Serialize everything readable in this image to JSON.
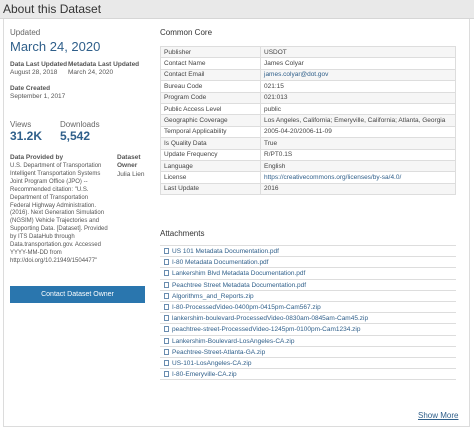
{
  "header": {
    "title": "About this Dataset"
  },
  "summary": {
    "updated_label": "Updated",
    "updated_date": "March 24, 2020",
    "data_last_updated_label": "Data Last Updated",
    "data_last_updated": "August 28, 2018",
    "metadata_last_updated_label": "Metadata Last Updated",
    "metadata_last_updated": "March 24, 2020",
    "date_created_label": "Date Created",
    "date_created": "September 1, 2017",
    "views_label": "Views",
    "views": "31.2K",
    "downloads_label": "Downloads",
    "downloads": "5,542",
    "provided_by_label": "Data Provided by",
    "provided_by": "U.S. Department of Transportation Intelligent Transportation Systems Joint Program Office (JPO) -- Recommended citation: \"U.S. Department of Transportation Federal Highway Administration. (2016). Next Generation Simulation (NGSIM) Vehicle Trajectories and Supporting Data. [Dataset]. Provided by ITS DataHub through Data.transportation.gov. Accessed YYYY-MM-DD from http://doi.org/10.21949/1504477\"",
    "owner_label": "Dataset Owner",
    "owner": "Julia Lien",
    "contact_button": "Contact Dataset Owner"
  },
  "common_core": {
    "title": "Common Core",
    "rows": [
      {
        "key": "Publisher",
        "value": "USDOT",
        "link": false
      },
      {
        "key": "Contact Name",
        "value": "James Colyar",
        "link": false
      },
      {
        "key": "Contact Email",
        "value": "james.colyar@dot.gov",
        "link": true
      },
      {
        "key": "Bureau Code",
        "value": "021:15",
        "link": false
      },
      {
        "key": "Program Code",
        "value": "021:013",
        "link": false
      },
      {
        "key": "Public Access Level",
        "value": "public",
        "link": false
      },
      {
        "key": "Geographic Coverage",
        "value": "Los Angeles, California; Emeryville, California; Atlanta, Georgia",
        "link": false
      },
      {
        "key": "Temporal Applicability",
        "value": "2005-04-20/2006-11-09",
        "link": false
      },
      {
        "key": "Is Quality Data",
        "value": "True",
        "link": false
      },
      {
        "key": "Update Frequency",
        "value": "R/PT0.1S",
        "link": false
      },
      {
        "key": "Language",
        "value": "English",
        "link": false
      },
      {
        "key": "License",
        "value": "https://creativecommons.org/licenses/by-sa/4.0/",
        "link": true
      },
      {
        "key": "Last Update",
        "value": "2016",
        "link": false
      }
    ]
  },
  "attachments": {
    "title": "Attachments",
    "items": [
      "US 101 Metadata Documentation.pdf",
      "I-80 Metadata Documentation.pdf",
      "Lankershim Blvd Metadata Documentation.pdf",
      "Peachtree Street Metadata Documentation.pdf",
      "Algorithms_and_Reports.zip",
      "I-80-ProcessedVideo-0400pm-0415pm-Cam567.zip",
      "lankershim-boulevard-ProcessedVideo-0830am-0845am-Cam45.zip",
      "peachtree-street-ProcessedVideo-1245pm-0100pm-Cam1234.zip",
      "Lankershim-Boulevard-LosAngeles-CA.zip",
      "Peachtree-Street-Atlanta-GA.zip",
      "US-101-LosAngeles-CA.zip",
      "I-80-Emeryville-CA.zip"
    ],
    "show_more": "Show More"
  }
}
